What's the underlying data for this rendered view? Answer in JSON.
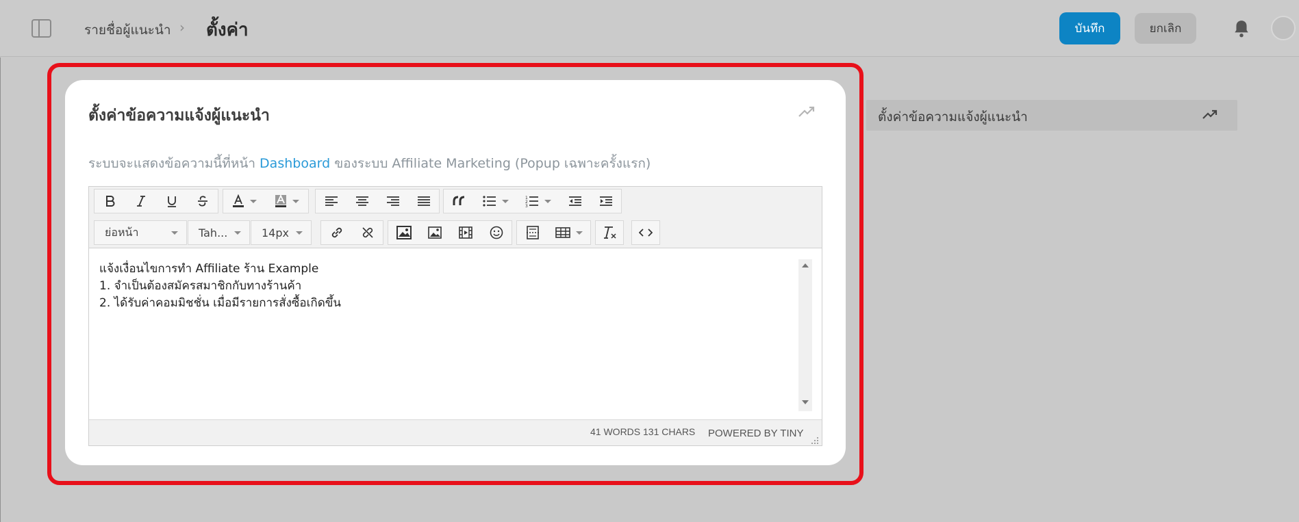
{
  "header": {
    "breadcrumb": "รายชื่อผู้แนะนำ",
    "separator": "›",
    "title": "ตั้งค่า",
    "save_label": "บันทึก",
    "cancel_label": "ยกเลิก"
  },
  "card": {
    "title": "ตั้งค่าข้อความแจ้งผู้แนะนำ",
    "desc_before": "ระบบจะแสดงข้อความนี้ที่หน้า",
    "desc_link": "Dashboard",
    "desc_after": "ของระบบ Affiliate Marketing (Popup เฉพาะครั้งแรก)"
  },
  "editor": {
    "format_select": "ย่อหน้า",
    "font_select": "Tah...",
    "size_select": "14px",
    "lines": [
      "แจ้งเงื่อนไขการทำ Affiliate ร้าน Example",
      "1. จำเป็นต้องสมัครสมาชิกกับทางร้านค้า",
      "2. ได้รับค่าคอมมิชชั่น เมื่อมีรายการสั่งซื้อเกิดขึ้น"
    ],
    "word_count": "41 WORDS 131 CHARS",
    "powered_by": "POWERED BY TINY"
  },
  "side_panel": {
    "item_label": "ตั้งค่าข้อความแจ้งผู้แนะนำ"
  },
  "colors": {
    "accent": "#0d84c4",
    "highlight": "#e8101a",
    "link": "#2a9ad8"
  }
}
